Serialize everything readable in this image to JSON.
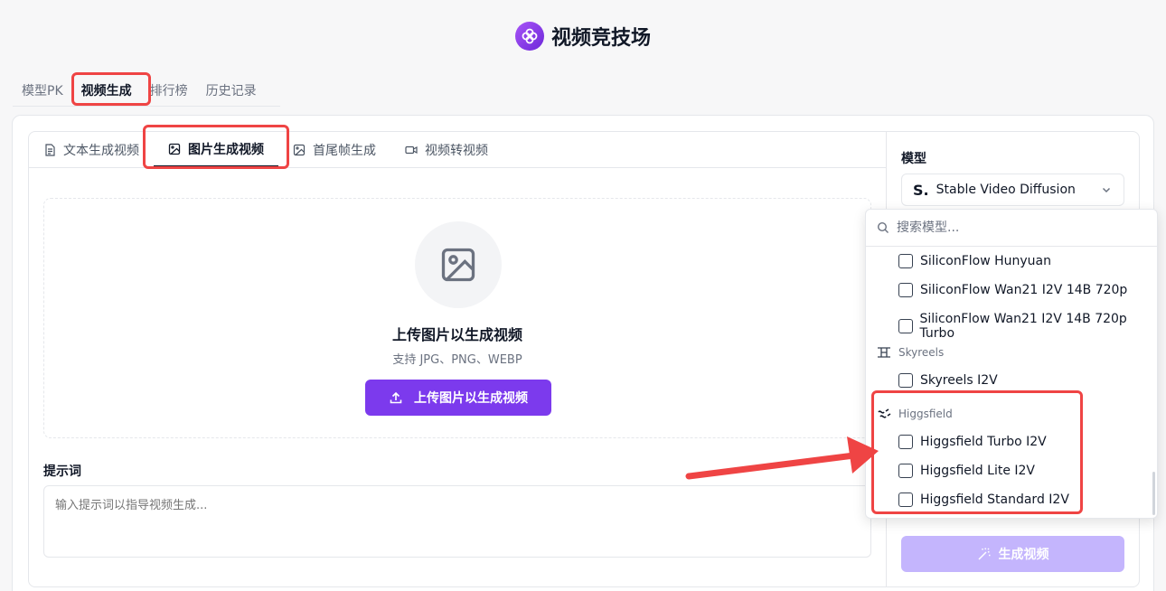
{
  "app": {
    "title": "视频竞技场"
  },
  "top_tabs": [
    {
      "label": "模型PK"
    },
    {
      "label": "视频生成"
    },
    {
      "label": "排行榜"
    },
    {
      "label": "历史记录"
    }
  ],
  "sub_tabs": [
    {
      "label": "文本生成视频",
      "icon": "document-icon"
    },
    {
      "label": "图片生成视频",
      "icon": "image-icon"
    },
    {
      "label": "首尾帧生成",
      "icon": "image-icon"
    },
    {
      "label": "视频转视频",
      "icon": "video-icon"
    }
  ],
  "upload": {
    "title": "上传图片以生成视频",
    "hint": "支持 JPG、PNG、WEBP",
    "button_label": "上传图片以生成视频"
  },
  "prompt": {
    "label": "提示词",
    "placeholder": "输入提示词以指导视频生成..."
  },
  "model": {
    "label": "模型",
    "selected": "Stable Video Diffusion",
    "selected_logo": "S."
  },
  "dropdown": {
    "search_placeholder": "搜索模型...",
    "items": [
      {
        "label": "SiliconFlow Hunyuan"
      },
      {
        "label": "SiliconFlow Wan21 I2V 14B 720p"
      },
      {
        "label": "SiliconFlow Wan21 I2V 14B 720p Turbo"
      }
    ],
    "groups": [
      {
        "name": "Skyreels",
        "items": [
          {
            "label": "Skyreels I2V"
          }
        ]
      },
      {
        "name": "Higgsfield",
        "items": [
          {
            "label": "Higgsfield Turbo I2V"
          },
          {
            "label": "Higgsfield Lite I2V"
          },
          {
            "label": "Higgsfield Standard I2V"
          }
        ]
      }
    ]
  },
  "generate_button": {
    "label": "生成视频"
  },
  "colors": {
    "accent": "#7c3aed",
    "accent_disabled": "#c4b5fd",
    "highlight": "#ef4444"
  }
}
